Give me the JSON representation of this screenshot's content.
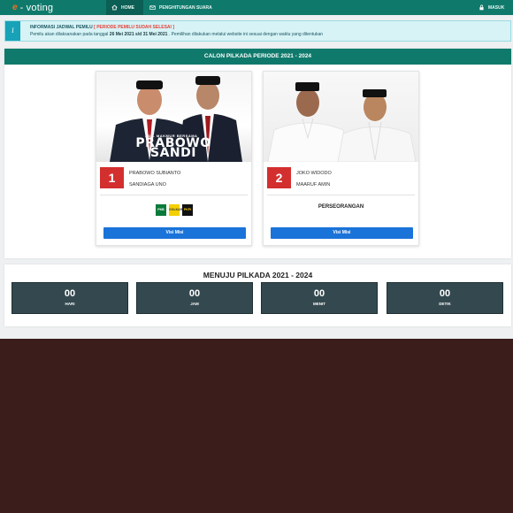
{
  "nav": {
    "brand": "- voting",
    "brand_mark": "e",
    "home": "HOME",
    "count_votes": "PENGHITUNGAN SUARA",
    "login": "MASUK",
    "colors": {
      "bar": "#0f7a6c",
      "active": "#0b5f54",
      "logo": "#f37021"
    }
  },
  "alert": {
    "icon": "i",
    "title": "INFORMASI JADWAL PEMILU",
    "status": "[ PERIODE PEMILU SUDAH SELESAI ]",
    "line2_prefix": "Pemilu akan dilaksanakan pada tanggal",
    "date_range": "26 Mei 2021 s/d 31 Mei 2021",
    "line2_suffix": ". Pemilihan dilakukan melalui website ini sesuai dengan waktu yang ditentukan"
  },
  "candidates_panel": {
    "title": "CALON PILKADA PERIODE 2021 - 2024",
    "candidates": [
      {
        "number": "1",
        "name_a": "PRABOWO SUBIANTO",
        "name_b": "SANDIAGA UNO",
        "photo_caption_small": "ADIL MAKMUR BERSAMA",
        "photo_caption": "PRABOWO SANDI",
        "parties": [
          "PKB",
          "GOLKAR",
          "PKPI"
        ],
        "button": "Visi Misi"
      },
      {
        "number": "2",
        "name_a": "JOKO WIDODO",
        "name_b": "MAARUF AMIN",
        "support": "PERSEORANGAN",
        "button": "Visi Misi"
      }
    ]
  },
  "countdown": {
    "title": "MENUJU PILKADA 2021 - 2024",
    "units": [
      {
        "value": "00",
        "label": "HARI"
      },
      {
        "value": "00",
        "label": "JAM"
      },
      {
        "value": "00",
        "label": "MENIT"
      },
      {
        "value": "00",
        "label": "DETIK"
      }
    ]
  }
}
